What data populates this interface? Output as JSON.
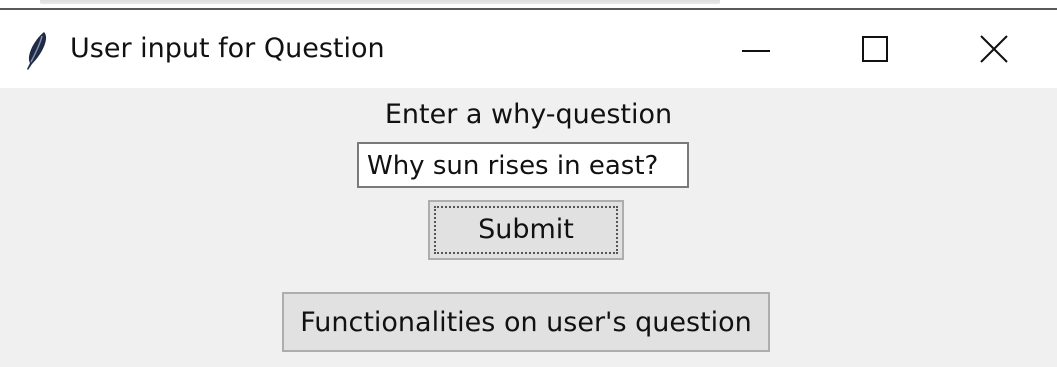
{
  "window": {
    "title": "User input for Question",
    "icon": "feather-icon",
    "controls": [
      "minimize-icon",
      "maximize-icon",
      "close-icon"
    ]
  },
  "form": {
    "prompt_label": "Enter a why-question",
    "question_value": "Why sun rises in east?",
    "submit_label": "Submit",
    "functionalities_label": "Functionalities on user's question"
  }
}
